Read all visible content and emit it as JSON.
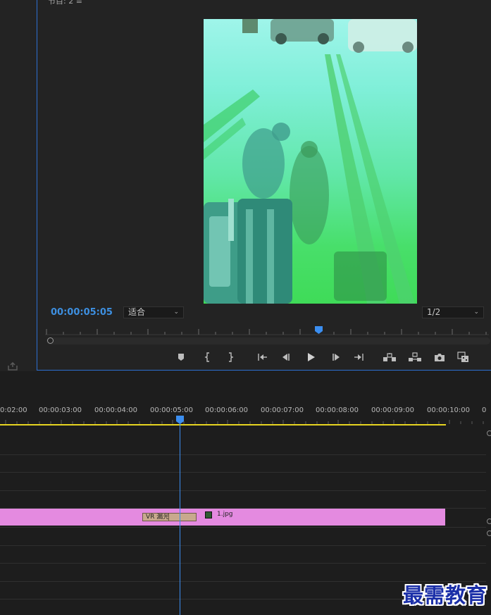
{
  "monitor": {
    "tab_label": "节目: 2  ≡",
    "timecode": "00:00:05:05",
    "fit_select": "适合",
    "resolution_select": "1/2",
    "accent_color": "#3d8fe0"
  },
  "transport": {
    "icons": [
      "marker-icon",
      "mark-in-icon",
      "mark-out-icon",
      "go-to-in-icon",
      "step-back-icon",
      "play-icon",
      "step-forward-icon",
      "go-to-out-icon",
      "lift-icon",
      "extract-icon",
      "camera-icon",
      "compare-icon"
    ]
  },
  "timeline": {
    "ruler_labels": [
      "0:02:00",
      "00:00:03:00",
      "00:00:04:00",
      "00:00:05:00",
      "00:00:06:00",
      "00:00:07:00",
      "00:00:08:00",
      "00:00:09:00",
      "00:00:10:00",
      "0"
    ],
    "clip": {
      "name": "1.jpg",
      "color": "#e48ae0"
    },
    "transition": {
      "name": "VR 漏光",
      "color": "#c8a98d"
    },
    "work_area_color": "#e6d420",
    "playhead_color": "#3b8ef0"
  },
  "watermark": "最需教育"
}
